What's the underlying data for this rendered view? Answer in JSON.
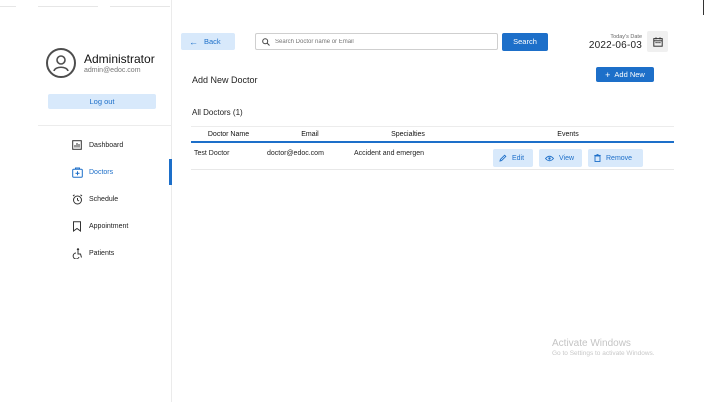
{
  "sidebar": {
    "profile": {
      "name": "Administrator",
      "email": "admin@edoc.com"
    },
    "logout_label": "Log out",
    "nav": [
      {
        "label": "Dashboard",
        "icon": "dashboard-icon",
        "active": false
      },
      {
        "label": "Doctors",
        "icon": "doctor-icon",
        "active": true
      },
      {
        "label": "Schedule",
        "icon": "alarm-icon",
        "active": false
      },
      {
        "label": "Appointment",
        "icon": "bookmark-icon",
        "active": false
      },
      {
        "label": "Patients",
        "icon": "accessibility-icon",
        "active": false
      }
    ]
  },
  "header": {
    "back_label": "Back",
    "search_placeholder": "Search Doctor name or Email",
    "search_value": "",
    "search_button": "Search",
    "date_label": "Today's Date",
    "date_value": "2022-06-03"
  },
  "main": {
    "title": "Add New Doctor",
    "add_button": "Add New",
    "section_title": "All Doctors (1)",
    "table": {
      "columns": [
        "Doctor Name",
        "Email",
        "Specialties",
        "Events"
      ],
      "rows": [
        {
          "name": "Test Doctor",
          "email": "doctor@edoc.com",
          "specialty": "Accident and emergen"
        }
      ],
      "actions": {
        "edit": "Edit",
        "view": "View",
        "remove": "Remove"
      }
    }
  },
  "watermark": {
    "line1": "Activate Windows",
    "line2": "Go to Settings to activate Windows."
  },
  "colors": {
    "accent": "#1d6fc9",
    "accent_light": "#d8e9fb"
  }
}
